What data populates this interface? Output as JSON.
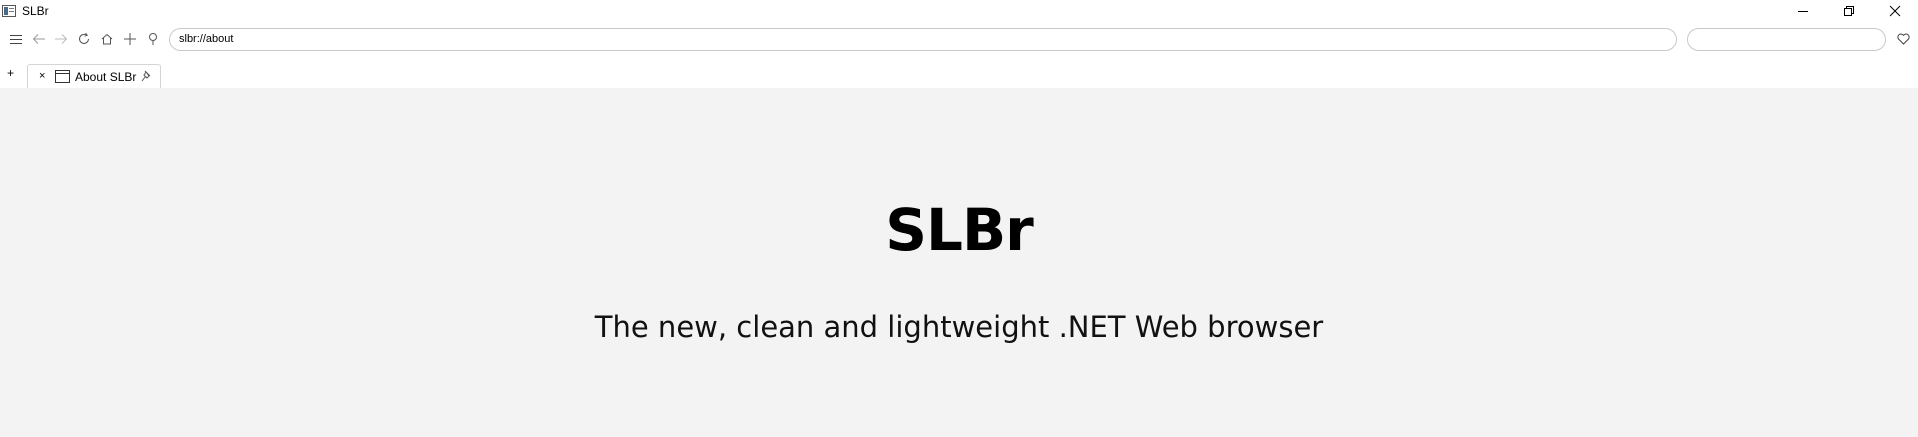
{
  "window": {
    "title": "SLBr",
    "controls": [
      "minimize-icon",
      "restore-icon",
      "close-icon"
    ]
  },
  "toolbar": {
    "icons": [
      "menu-icon",
      "back-icon",
      "forward-icon",
      "reload-icon",
      "home-icon",
      "add-icon",
      "location-pin-icon"
    ],
    "address_value": "slbr://about",
    "search_value": "",
    "favorite_icon": "heart-icon"
  },
  "tabs": {
    "new_tab_label": "+",
    "items": [
      {
        "close_label": "×",
        "label": "About SLBr",
        "icon": "page-icon",
        "pin_icon": "pin-icon"
      }
    ]
  },
  "page": {
    "heading": "SLBr",
    "subtitle": "The new, clean and lightweight .NET Web browser"
  },
  "colors": {
    "content_background": "#f3f3f3",
    "chrome_background": "#ffffff",
    "border": "#c9c9c9"
  }
}
